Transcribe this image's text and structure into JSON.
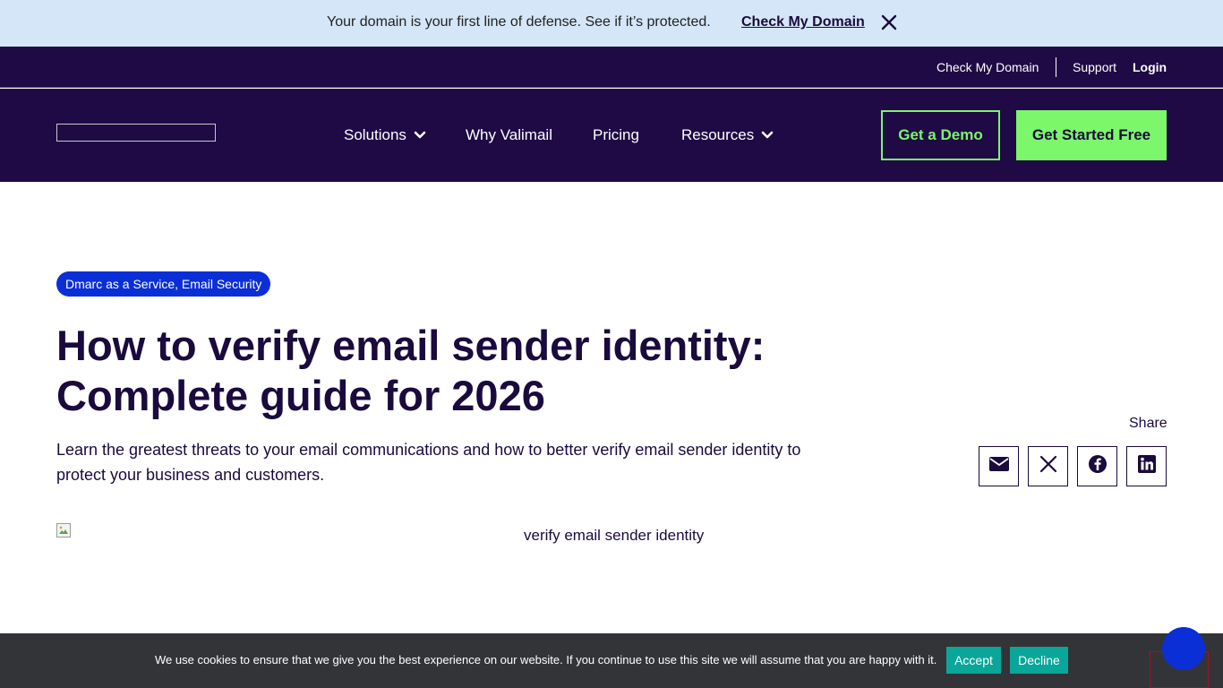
{
  "announcement": {
    "text": "Your domain is your first line of defense. See if it’s protected.",
    "link_label": "Check My Domain",
    "close_icon": "close-icon"
  },
  "utility_nav": {
    "check_domain": "Check My Domain",
    "support": "Support",
    "login": "Login"
  },
  "main_nav": {
    "items": [
      {
        "label": "Solutions",
        "has_dropdown": true
      },
      {
        "label": "Why Valimail",
        "has_dropdown": false
      },
      {
        "label": "Pricing",
        "has_dropdown": false
      },
      {
        "label": "Resources",
        "has_dropdown": true
      }
    ],
    "demo_button": "Get a Demo",
    "start_button": "Get Started Free"
  },
  "article": {
    "category_tag": "Dmarc as a Service, Email Security",
    "title_line1": "How to verify email sender identity:",
    "title_line2": "Complete guide for 2026",
    "lede": "Learn the greatest threats to your email communications and how to better verify email sender identity to protect your business and customers.",
    "share_label": "Share",
    "share_icons": [
      "email-icon",
      "x-icon",
      "facebook-icon",
      "linkedin-icon"
    ],
    "hero_alt": "verify email sender identity"
  },
  "cookie_banner": {
    "text": "We use cookies to ensure that we give you the best experience on our website. If you continue to use this site we will assume that you are happy with it.",
    "accept": "Accept",
    "decline": "Decline"
  },
  "colors": {
    "nav_bg": "#1f0a45",
    "announce_bg": "#d4e6f7",
    "accent_green": "#7cf66a",
    "tag_blue": "#0b2fd6",
    "cookie_bg": "#333438",
    "cookie_button": "#0aa69a"
  }
}
